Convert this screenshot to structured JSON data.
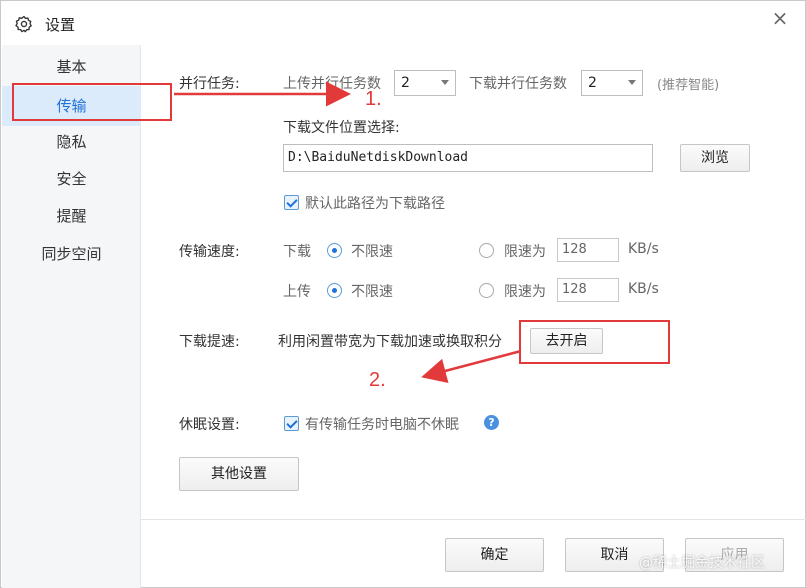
{
  "window": {
    "title": "设置",
    "close_glyph": "×"
  },
  "sidebar": {
    "items": [
      {
        "label": "基本"
      },
      {
        "label": "传输",
        "active": true
      },
      {
        "label": "隐私"
      },
      {
        "label": "安全"
      },
      {
        "label": "提醒"
      },
      {
        "label": "同步空间"
      }
    ]
  },
  "parallel": {
    "label": "并行任务:",
    "upload_label": "上传并行任务数",
    "upload_value": "2",
    "download_label": "下载并行任务数",
    "download_value": "2",
    "hint": "(推荐智能)"
  },
  "download_location": {
    "label": "下载文件位置选择:",
    "path": "D:\\BaiduNetdiskDownload",
    "browse_button": "浏览",
    "default_checkbox_label": "默认此路径为下载路径",
    "default_checked": true
  },
  "speed": {
    "label": "传输速度:",
    "download": {
      "label": "下载",
      "unlimited_label": "不限速",
      "limit_label": "限速为",
      "value": "128",
      "unit": "KB/s",
      "mode": "unlimited"
    },
    "upload": {
      "label": "上传",
      "unlimited_label": "不限速",
      "limit_label": "限速为",
      "value": "128",
      "unit": "KB/s",
      "mode": "unlimited"
    }
  },
  "boost": {
    "label": "下载提速:",
    "description": "利用闲置带宽为下载加速或换取积分",
    "button": "去开启"
  },
  "sleep": {
    "label": "休眠设置:",
    "checkbox_label": "有传输任务时电脑不休眠",
    "checked": true,
    "help_glyph": "?"
  },
  "other_settings_button": "其他设置",
  "footer": {
    "ok": "确定",
    "cancel": "取消",
    "apply": "应用"
  },
  "annotations": {
    "step1": "1.",
    "step2": "2.",
    "color": "#e23a3a"
  },
  "watermark": "@稀土掘金技术社区",
  "colors": {
    "accent": "#1e72d8",
    "sidebar_active_bg": "#dcebfb",
    "annotation": "#e23a3a"
  },
  "icons": {
    "title": "gear-icon",
    "help": "question-circle-icon"
  }
}
